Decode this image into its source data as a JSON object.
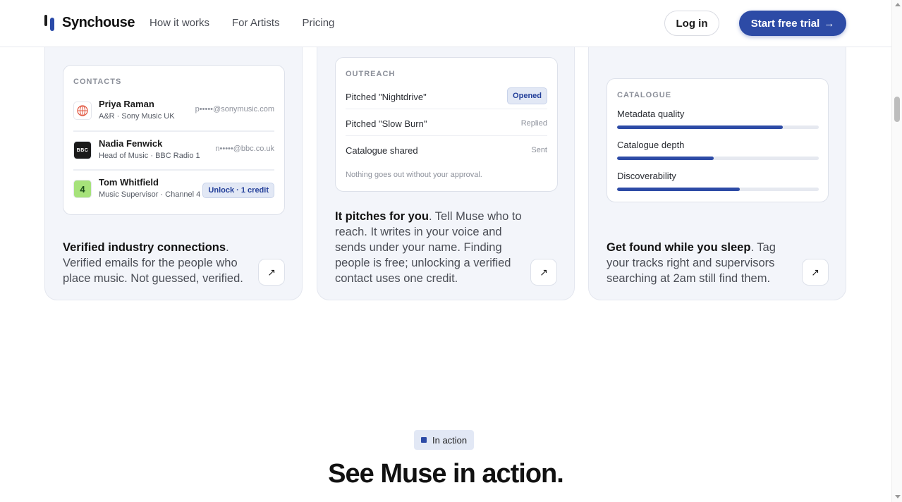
{
  "header": {
    "brand": "Synchouse",
    "nav": [
      "How it works",
      "For Artists",
      "Pricing"
    ],
    "login_label": "Log in",
    "trial_label": "Start free trial",
    "trial_arrow": "→"
  },
  "cards": [
    {
      "panel_label": "CONTACTS",
      "contacts": [
        {
          "name": "Priya Raman",
          "role": "A&R · Sony Music UK",
          "email": "p•••••@sonymusic.com",
          "logo": "sony-music-logo"
        },
        {
          "name": "Nadia Fenwick",
          "role": "Head of Music · BBC Radio 1",
          "email": "n•••••@bbc.co.uk",
          "logo_text": "BBC"
        },
        {
          "name": "Tom Whitfield",
          "role": "Music Supervisor · Channel 4",
          "unlock": "Unlock · 1 credit",
          "logo_text": "4"
        }
      ],
      "title": "Verified industry connections",
      "body": ". Verified emails for the people who place music. Not guessed, verified."
    },
    {
      "panel_label": "OUTREACH",
      "rows": [
        {
          "text": "Pitched \"Nightdrive\"",
          "status": "Opened"
        },
        {
          "text": "Pitched \"Slow Burn\"",
          "status": "Replied"
        },
        {
          "text": "Catalogue shared",
          "status": "Sent"
        }
      ],
      "note": "Nothing goes out without your approval.",
      "title": "It pitches for you",
      "body": ". Tell Muse who to reach. It writes in your voice and sends under your name. Finding people is free; unlocking a verified contact uses one credit."
    },
    {
      "panel_label": "CATALOGUE",
      "meters": [
        {
          "label": "Metadata quality",
          "value": 0.82
        },
        {
          "label": "Catalogue depth",
          "value": 0.48
        },
        {
          "label": "Discoverability",
          "value": 0.61
        }
      ],
      "title": "Get found while you sleep",
      "body": ". Tag your tracks right and supervisors searching at 2am still find them."
    }
  ],
  "arrow_glyph": "↗",
  "section": {
    "pill": "In action",
    "heading": "See Muse in action."
  },
  "colors": {
    "accent": "#2d4ba6",
    "card_bg": "#f3f5fa",
    "badge_bg": "#e2e8f5"
  }
}
